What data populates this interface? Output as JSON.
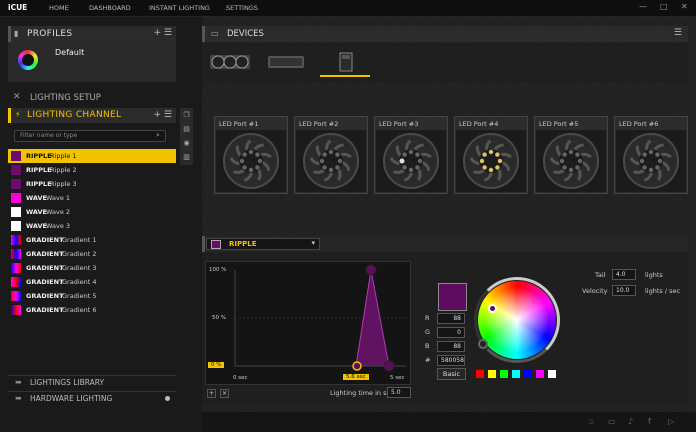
{
  "app": {
    "brand": "iCUE"
  },
  "nav": [
    {
      "label": "HOME"
    },
    {
      "label": "DASHBOARD"
    },
    {
      "label": "INSTANT LIGHTING"
    },
    {
      "label": "SETTINGS"
    }
  ],
  "window": {
    "minimize": "—",
    "maximize": "□",
    "close": "✕"
  },
  "profiles": {
    "title": "PROFILES",
    "add": "+",
    "menu": "☰",
    "items": [
      {
        "name": "Default"
      }
    ]
  },
  "lighting_setup": {
    "title": "LIGHTING SETUP"
  },
  "lighting_channel": {
    "title": "LIGHTING CHANNEL",
    "add": "+",
    "menu": "☰"
  },
  "search": {
    "placeholder": "Filter name or type",
    "value": ""
  },
  "effects": [
    {
      "type": "RIPPLE",
      "name": "Ripple 1",
      "swatch": "#6b0b6b",
      "selected": true
    },
    {
      "type": "RIPPLE",
      "name": "Ripple 2",
      "swatch": "#6b0b6b"
    },
    {
      "type": "RIPPLE",
      "name": "Ripple 3",
      "swatch": "#6b0b6b"
    },
    {
      "type": "WAVE",
      "name": "Wave 1",
      "swatch": "#ff00d8"
    },
    {
      "type": "WAVE",
      "name": "Wave 2",
      "swatch": "#ffffff"
    },
    {
      "type": "WAVE",
      "name": "Wave 3",
      "swatch": "#ffffff"
    },
    {
      "type": "GRADIENT",
      "name": "Gradient 1",
      "swatch": "grad1"
    },
    {
      "type": "GRADIENT",
      "name": "Gradient 2",
      "swatch": "grad2"
    },
    {
      "type": "GRADIENT",
      "name": "Gradient 3",
      "swatch": "grad3"
    },
    {
      "type": "GRADIENT",
      "name": "Gradient 4",
      "swatch": "grad4"
    },
    {
      "type": "GRADIENT",
      "name": "Gradient 5",
      "swatch": "grad5"
    },
    {
      "type": "GRADIENT",
      "name": "Gradient 6",
      "swatch": "grad6"
    }
  ],
  "library": {
    "label": "LIGHTINGS LIBRARY"
  },
  "hardware": {
    "label": "HARDWARE LIGHTING"
  },
  "devices": {
    "title": "DEVICES",
    "menu": "☰"
  },
  "ports": [
    {
      "label": "LED Port #1"
    },
    {
      "label": "LED Port #2"
    },
    {
      "label": "LED Port #3"
    },
    {
      "label": "LED Port #4"
    },
    {
      "label": "LED Port #5"
    },
    {
      "label": "LED Port #6"
    }
  ],
  "effect_panel": {
    "effect_name": "RIPPLE",
    "y_labels": [
      "100 %",
      "50 %",
      "0 %"
    ],
    "x_labels": [
      "0 sec",
      "5.6 sec",
      "5 sec"
    ],
    "lighting_time_label": "Lighting time in sec",
    "lighting_time_value": "5.0",
    "color": "#5e0c5e",
    "r_label": "R",
    "g_label": "G",
    "b_label": "B",
    "hex_label": "#",
    "r": "88",
    "g": "0",
    "b": "88",
    "hex": "580058",
    "basic_label": "Basic",
    "palette": [
      "#ff0000",
      "#ffff00",
      "#00ff00",
      "#00ffff",
      "#0000ff",
      "#ff00ff",
      "#ffffff"
    ],
    "tail_label": "Tail",
    "tail_value": "4.0",
    "tail_unit": "lights",
    "velocity_label": "Velocity",
    "velocity_value": "10.0",
    "velocity_unit": "lights / sec",
    "add": "+",
    "remove": "×"
  },
  "accent": "#f2c300"
}
